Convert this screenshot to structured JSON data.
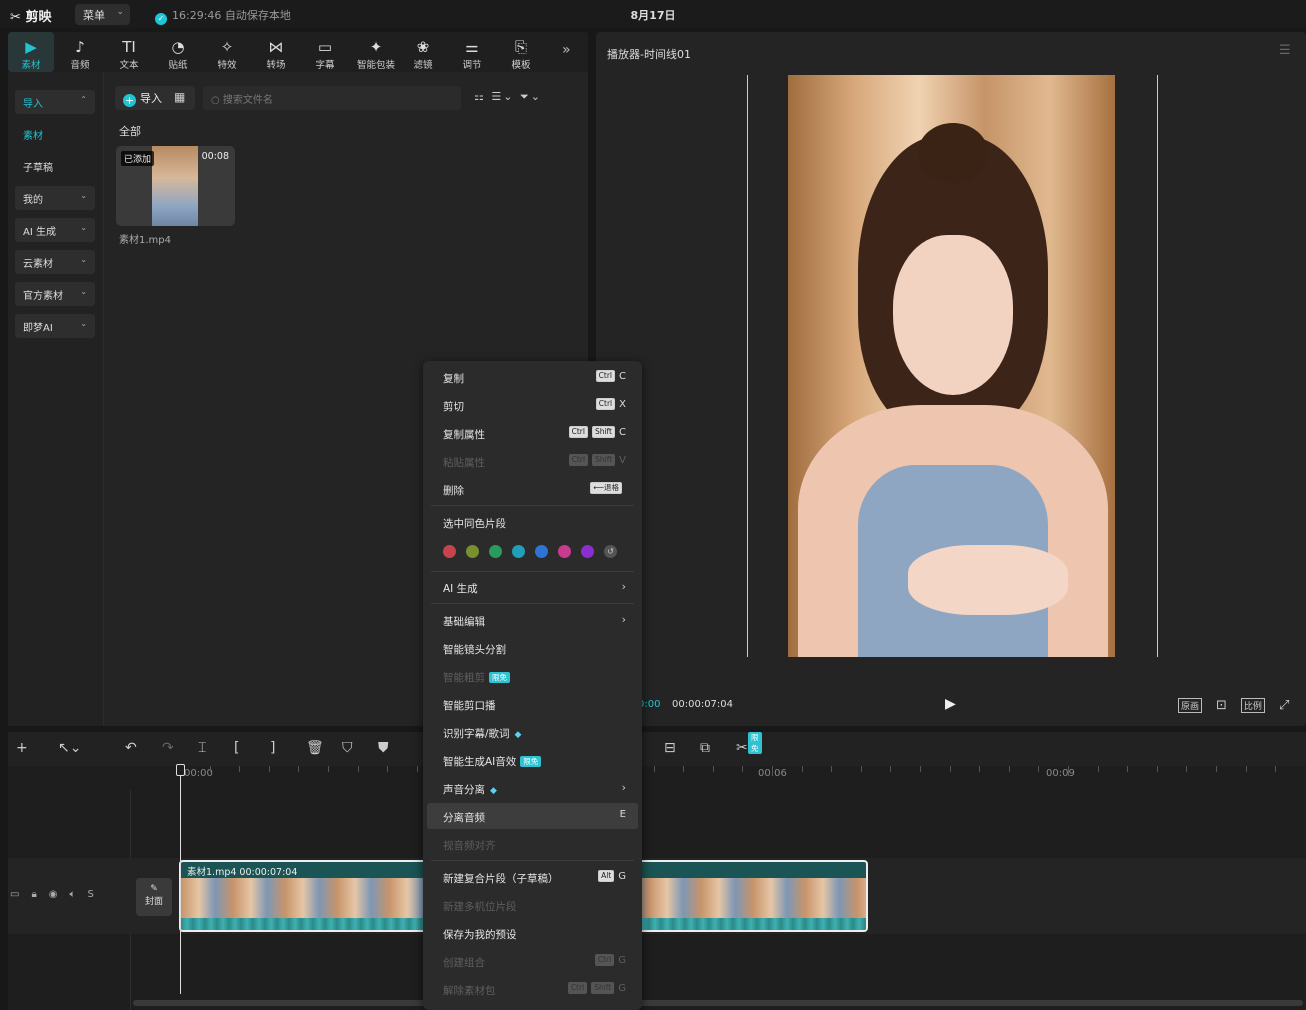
{
  "app": {
    "logo": "剪映",
    "menu_label": "菜单",
    "save_status": "16:29:46 自动保存本地",
    "date": "8月17日"
  },
  "toptabs": [
    {
      "label": "素材",
      "icon": "▶"
    },
    {
      "label": "音频",
      "icon": "♪"
    },
    {
      "label": "文本",
      "icon": "TI"
    },
    {
      "label": "贴纸",
      "icon": "◔"
    },
    {
      "label": "特效",
      "icon": "✧"
    },
    {
      "label": "转场",
      "icon": "⋈"
    },
    {
      "label": "字幕",
      "icon": "▭"
    },
    {
      "label": "智能包装",
      "icon": "✦"
    },
    {
      "label": "滤镜",
      "icon": "❀"
    },
    {
      "label": "调节",
      "icon": "⚌"
    },
    {
      "label": "模板",
      "icon": "⎘"
    }
  ],
  "sidenav": [
    {
      "label": "导入"
    },
    {
      "label": "素材"
    },
    {
      "label": "子草稿"
    },
    {
      "label": "我的"
    },
    {
      "label": "AI 生成"
    },
    {
      "label": "云素材"
    },
    {
      "label": "官方素材"
    },
    {
      "label": "即梦AI"
    }
  ],
  "media": {
    "import_label": "导入",
    "search_placeholder": "搜索文件名",
    "all_label": "全部",
    "item": {
      "badge": "已添加",
      "duration": "00:08",
      "name": "素材1.mp4"
    }
  },
  "player": {
    "title": "播放器-时间线01",
    "current_time": "0:00",
    "total_time": "00:00:07:04",
    "btn_original": "原画",
    "btn_ratio": "比例"
  },
  "timeline": {
    "ruler": [
      "00:00",
      "00:06",
      "00:09"
    ],
    "clip_label": "素材1.mp4   00:00:07:04",
    "cover_label": "封面",
    "badge": "限免"
  },
  "context_menu": {
    "copy": "复制",
    "cut": "剪切",
    "copy_attr": "复制属性",
    "paste_attr": "粘贴属性",
    "delete": "删除",
    "delete_key": "⟵退格",
    "select_same_color": "选中同色片段",
    "ai_gen": "AI 生成",
    "basic_edit": "基础编辑",
    "smart_split": "智能镜头分割",
    "smart_rough": "智能粗剪",
    "smart_trim": "智能剪口播",
    "recog_sub": "识别字幕/歌词",
    "gen_ai_sfx": "智能生成AI音效",
    "voice_sep": "声音分离",
    "separate_audio": "分离音频",
    "av_align": "视音频对齐",
    "new_compound": "新建复合片段（子草稿）",
    "new_multicam": "新建多机位片段",
    "save_preset": "保存为我的预设",
    "create_group": "创建组合",
    "ungroup": "解除素材包",
    "badge_free": "限免",
    "k_ctrl": "Ctrl",
    "k_shift": "Shift",
    "k_alt": "Alt",
    "k_c": "C",
    "k_x": "X",
    "k_v": "V",
    "k_e": "E",
    "k_g": "G"
  },
  "colors": {
    "accent": "#21c4d0",
    "dots": [
      "#c7434d",
      "#7a8f2e",
      "#2b9a5a",
      "#1f9fb8",
      "#2e74d6",
      "#c93b8f",
      "#8a2ed0"
    ]
  }
}
